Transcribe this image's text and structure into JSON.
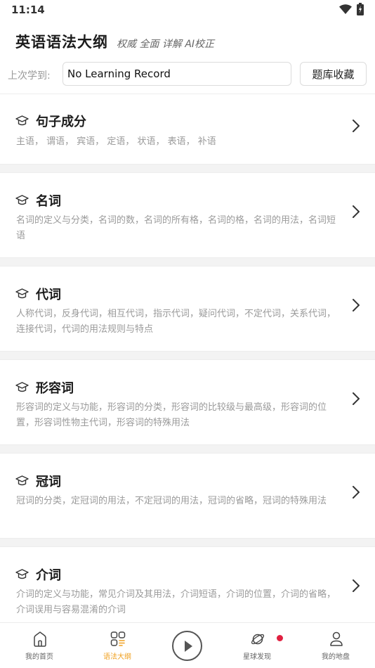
{
  "status": {
    "time": "11:14"
  },
  "header": {
    "title": "英语语法大纲",
    "subtitle": "权威 全面 详解 AI校正"
  },
  "record": {
    "label": "上次学到:",
    "value": "No Learning Record",
    "favorites_button": "题库收藏"
  },
  "sections": [
    {
      "title": "句子成分",
      "desc": "主语， 谓语， 宾语， 定语， 状语， 表语， 补语"
    },
    {
      "title": "名词",
      "desc": "名词的定义与分类，名词的数，名词的所有格，名词的格，名词的用法，名词短语"
    },
    {
      "title": "代词",
      "desc": "人称代词，反身代词，相互代词，指示代词，疑问代词，不定代词，关系代词，连接代词，代词的用法规则与特点"
    },
    {
      "title": "形容词",
      "desc": "形容词的定义与功能，形容词的分类，形容词的比较级与最高级，形容词的位置，形容词性物主代词，形容词的特殊用法"
    },
    {
      "title": "冠词",
      "desc": "冠词的分类，定冠词的用法，不定冠词的用法，冠词的省略，冠词的特殊用法"
    },
    {
      "title": "介词",
      "desc": "介词的定义与功能，常见介词及其用法，介词短语，介词的位置，介词的省略，介词误用与容易混淆的介词"
    }
  ],
  "nav": {
    "home": "我的首页",
    "grammar": "语法大纲",
    "discover": "星球发现",
    "mine": "我的地盘"
  },
  "colors": {
    "accent": "#f0a020",
    "notify": "#e02040",
    "text_muted": "#9a9a9a"
  },
  "icons": {
    "card": "graduation-cap-icon",
    "arrow": "chevron-right-icon",
    "play": "play-icon"
  }
}
